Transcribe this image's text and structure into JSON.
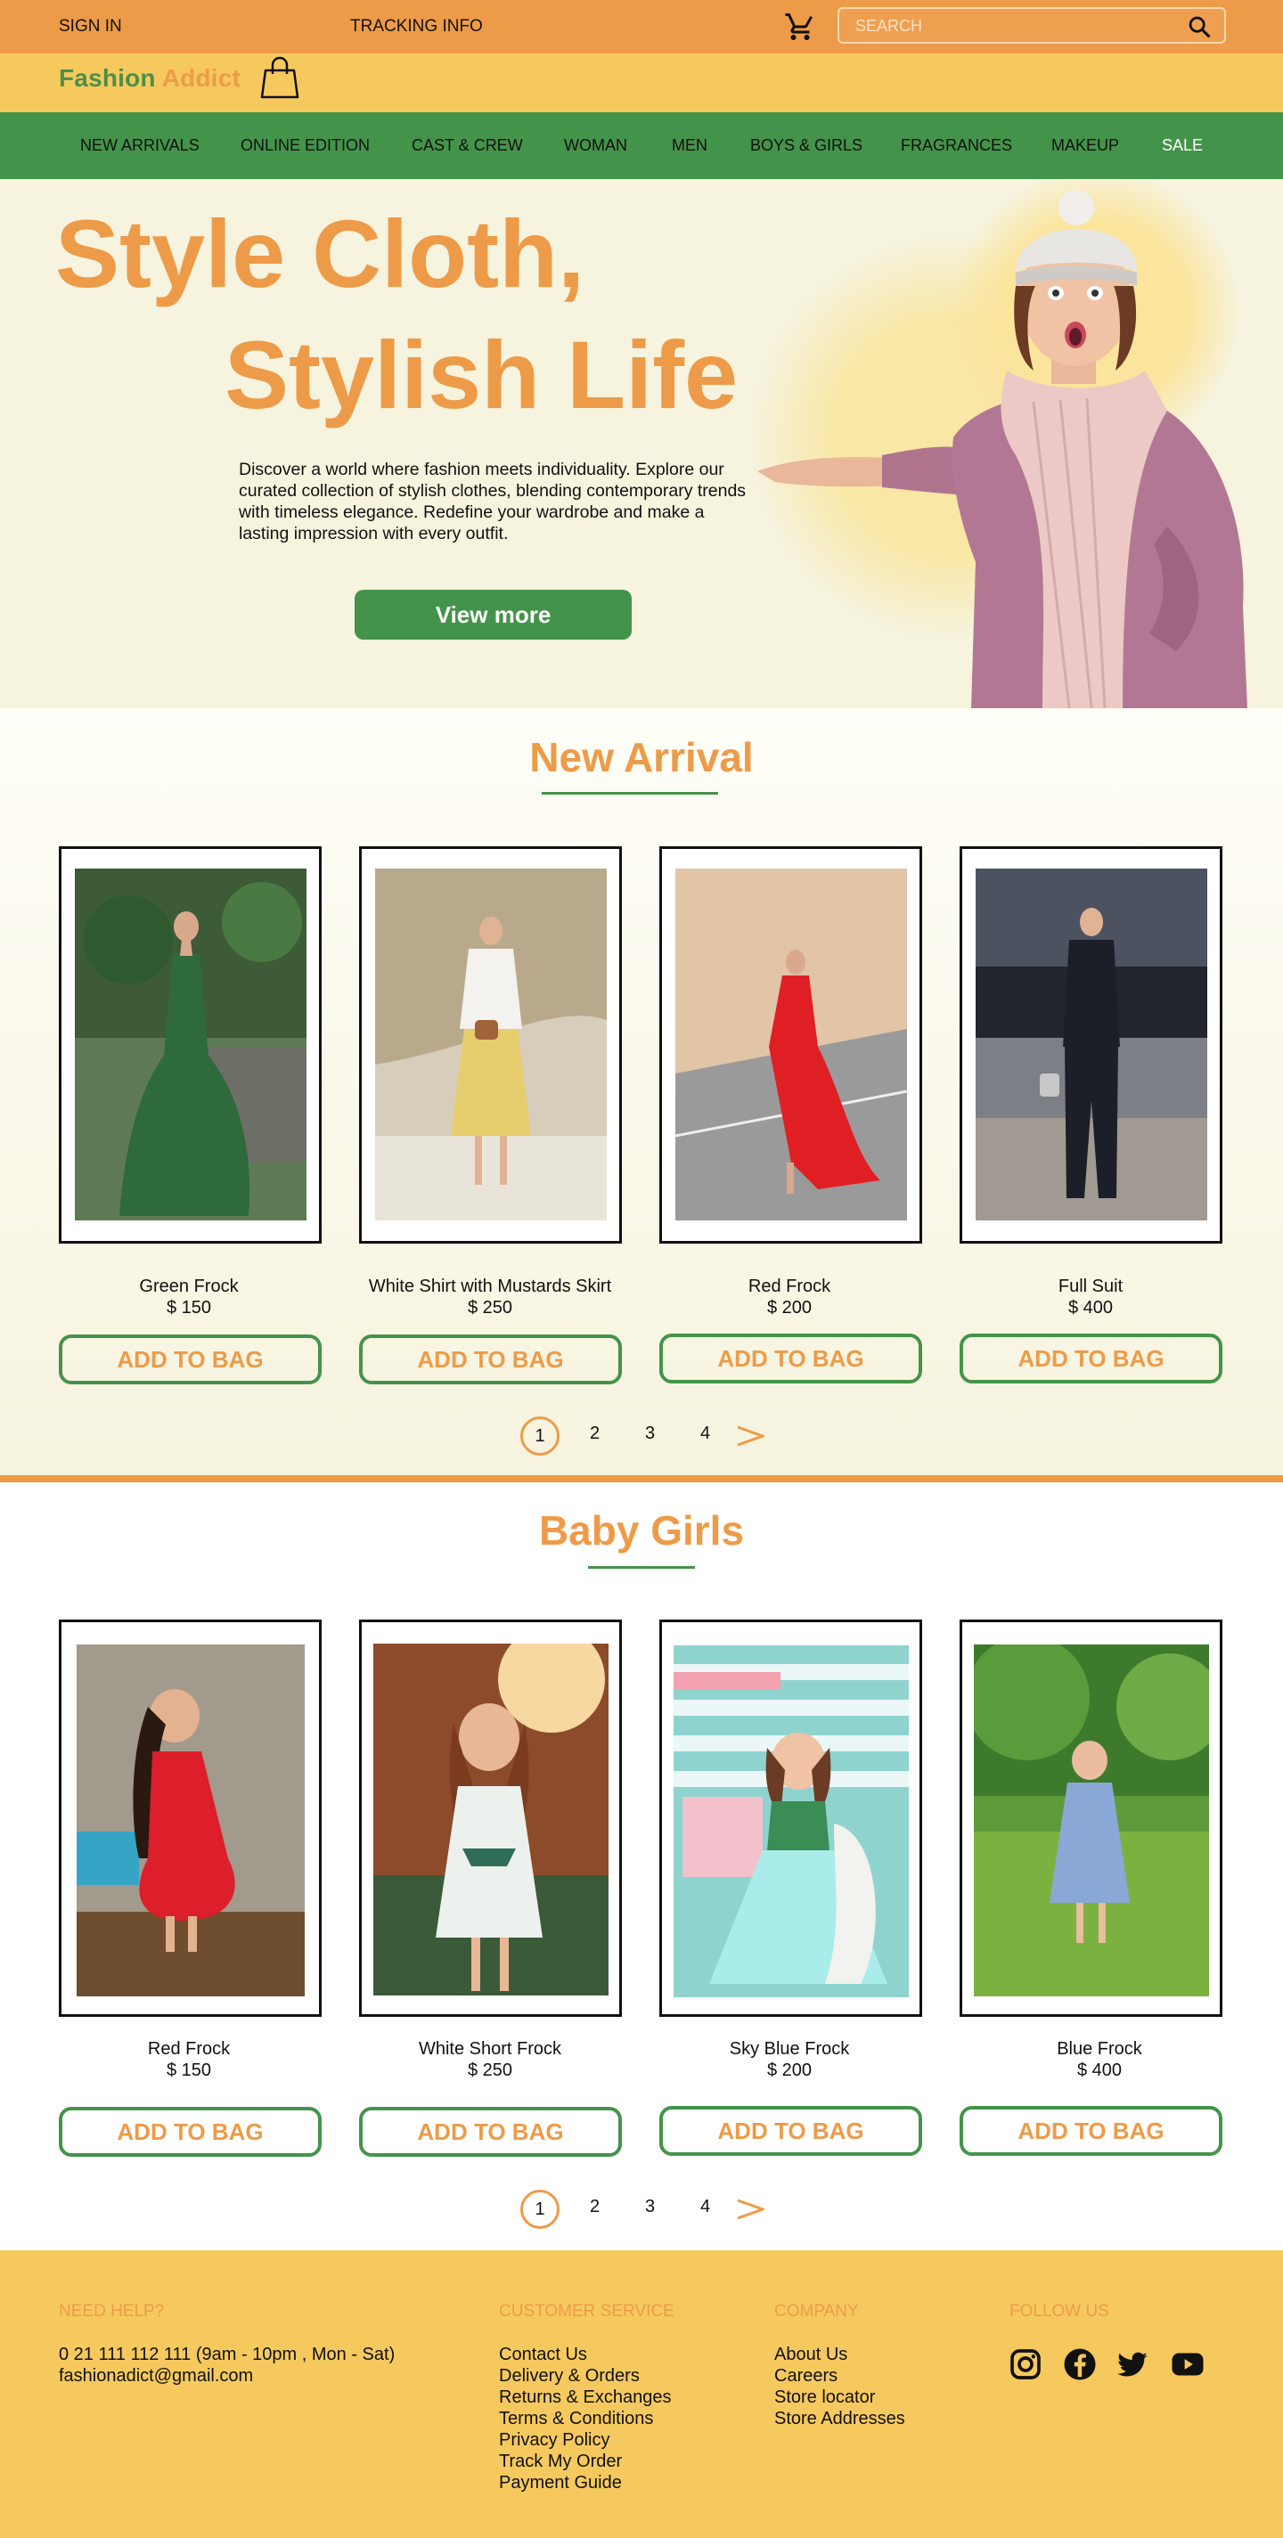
{
  "topbar": {
    "signin": "SIGN IN",
    "tracking": "TRACKING INFO",
    "search_placeholder": "SEARCH",
    "cart_icon": "cart-icon",
    "search_icon": "search-icon"
  },
  "logo": {
    "part1": "Fashion",
    "part2": "Addict",
    "icon": "shopping-bag-icon"
  },
  "nav": {
    "items": [
      "NEW ARRIVALS",
      "ONLINE EDITION",
      "CAST & CREW",
      "WOMAN",
      "MEN",
      "BOYS & GIRLS",
      "FRAGRANCES",
      "MAKEUP",
      "SALE"
    ]
  },
  "hero": {
    "line1": "Style Cloth,",
    "line2": "Stylish Life",
    "description": "Discover a world where fashion meets individuality. Explore our curated collection of stylish clothes,  blending contemporary trends with timeless elegance. Redefine your wardrobe and make a lasting impression with every outfit.",
    "button": "View more"
  },
  "new_arrival": {
    "title": "New Arrival",
    "products": [
      {
        "name": "Green Frock",
        "price": "$ 150",
        "button": "ADD TO BAG"
      },
      {
        "name": "White Shirt with Mustards Skirt",
        "price": "$ 250",
        "button": "ADD TO BAG"
      },
      {
        "name": "Red Frock",
        "price": "$ 200",
        "button": "ADD TO BAG"
      },
      {
        "name": "Full Suit",
        "price": "$ 400",
        "button": "ADD TO BAG"
      }
    ],
    "pages": [
      "1",
      "2",
      "3",
      "4"
    ]
  },
  "baby_girls": {
    "title": "Baby Girls",
    "products": [
      {
        "name": "Red Frock",
        "price": "$ 150",
        "button": "ADD TO BAG"
      },
      {
        "name": "White Short Frock",
        "price": "$ 250",
        "button": "ADD TO BAG"
      },
      {
        "name": "Sky Blue Frock",
        "price": "$ 200",
        "button": "ADD TO BAG"
      },
      {
        "name": "Blue Frock",
        "price": "$ 400",
        "button": "ADD TO BAG"
      }
    ],
    "pages": [
      "1",
      "2",
      "3",
      "4"
    ]
  },
  "footer": {
    "help": {
      "heading": "NEED HELP?",
      "phone": "0 21 111 112 111 (9am - 10pm , Mon - Sat)",
      "email": "fashionadict@gmail.com"
    },
    "customer_service": {
      "heading": "CUSTOMER SERVICE",
      "links": [
        "Contact Us",
        "Delivery & Orders",
        "Returns & Exchanges",
        "Terms & Conditions",
        "Privacy Policy",
        "Track My Order",
        "Payment Guide"
      ]
    },
    "company": {
      "heading": "COMPANY",
      "links": [
        "About Us",
        "Careers",
        "Store locator",
        "Store Addresses"
      ]
    },
    "follow": {
      "heading": "FOLLOW US",
      "icons": [
        "instagram-icon",
        "facebook-icon",
        "twitter-icon",
        "youtube-icon"
      ]
    }
  },
  "colors": {
    "orange": "#ED9B48",
    "yellow": "#F6C95F",
    "green": "#44934A",
    "cream": "#F6F3DE"
  }
}
